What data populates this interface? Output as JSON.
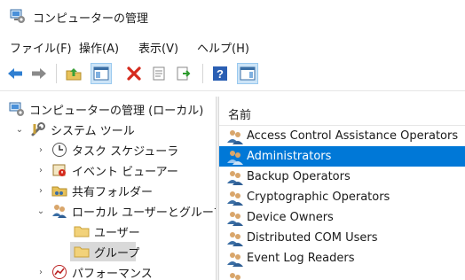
{
  "window": {
    "title": "コンピューターの管理"
  },
  "menu": [
    "ファイル(F)",
    "操作(A)",
    "表示(V)",
    "ヘルプ(H)"
  ],
  "toolbar": {
    "buttons": [
      "back-arrow-icon",
      "forward-arrow-icon",
      "up-folder-icon",
      "show-hide-tree-icon",
      "delete-icon",
      "properties-icon",
      "export-list-icon",
      "help-icon",
      "action-pane-icon"
    ]
  },
  "tree": {
    "root": "コンピューターの管理 (ローカル)",
    "system_tools": "システム ツール",
    "task_scheduler": "タスク スケジューラ",
    "event_viewer": "イベント ビューアー",
    "shared_folders": "共有フォルダー",
    "local_users_groups": "ローカル ユーザーとグループ",
    "users": "ユーザー",
    "groups": "グループ",
    "performance": "パフォーマンス"
  },
  "list": {
    "column_name": "名前",
    "items": [
      "Access Control Assistance Operators",
      "Administrators",
      "Backup Operators",
      "Cryptographic Operators",
      "Device Owners",
      "Distributed COM Users",
      "Event Log Readers"
    ],
    "selected_index": 1
  },
  "colors": {
    "selection": "#0078d7",
    "tree_selection": "#d9d9d9"
  }
}
